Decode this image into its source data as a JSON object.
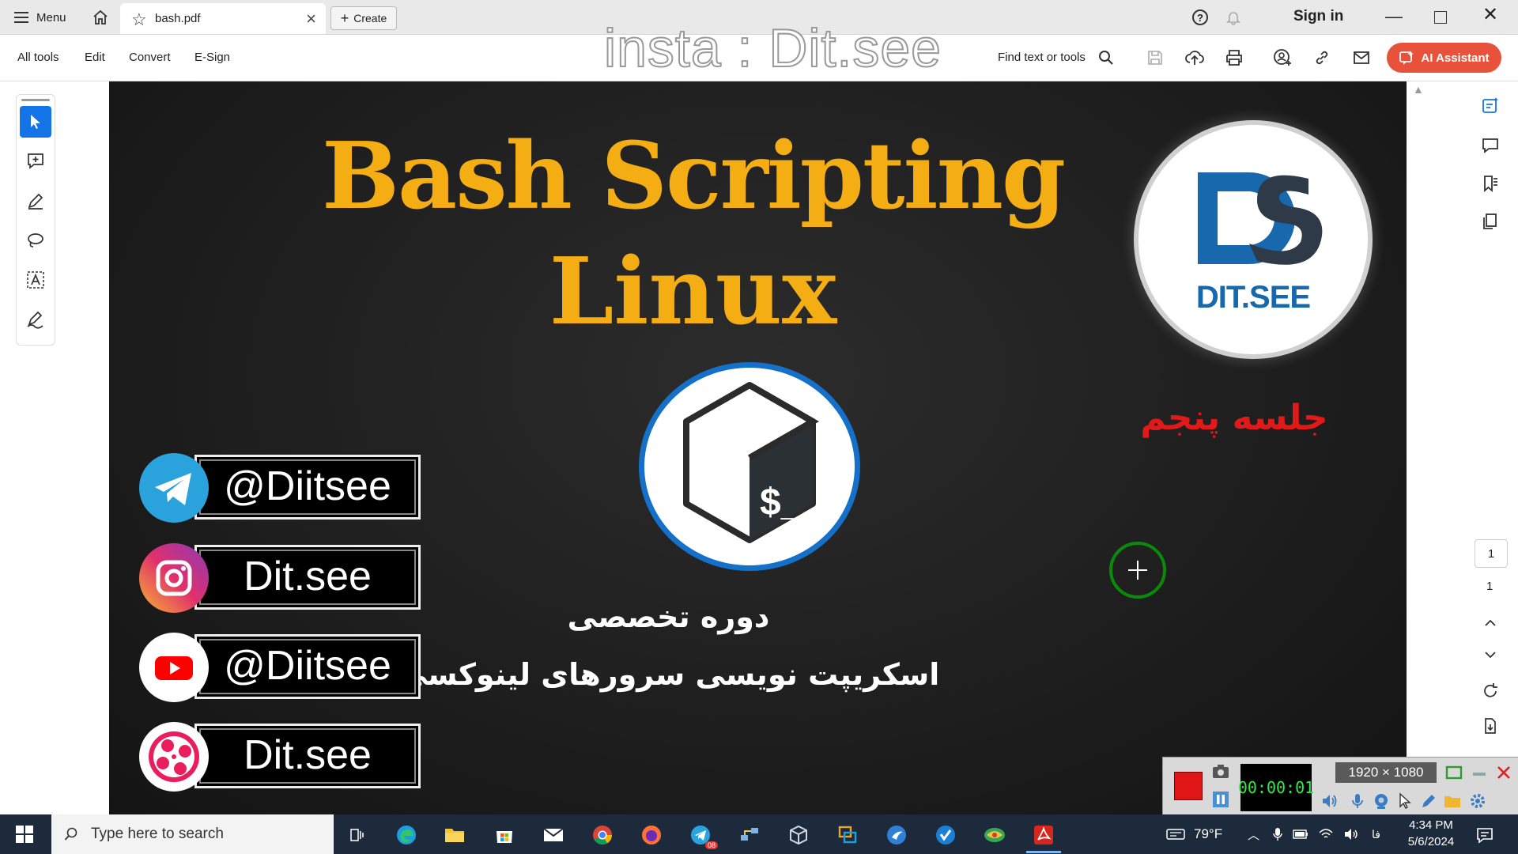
{
  "titlebar": {
    "menu_label": "Menu",
    "tab_title": "bash.pdf",
    "create_label": "Create",
    "sign_in": "Sign in",
    "help_glyph": "?"
  },
  "toolbar": {
    "all_tools": "All tools",
    "edit": "Edit",
    "convert": "Convert",
    "esign": "E-Sign",
    "watermark": "insta : Dit.see",
    "find": "Find text or tools",
    "ai_assistant": "AI Assistant"
  },
  "document": {
    "title_line1": "Bash Scripting",
    "title_line2": "Linux",
    "logo_text": "DIT.SEE",
    "session": "جلسه پنجم",
    "course_line1": "دوره تخصصی",
    "course_line2": "اسکریپت نویسی سرورهای لینوکسی",
    "bash_prompt": "$_",
    "socials": [
      {
        "platform": "telegram",
        "handle": "@Diitsee"
      },
      {
        "platform": "instagram",
        "handle": "Dit.see"
      },
      {
        "platform": "youtube",
        "handle": "@Diitsee"
      },
      {
        "platform": "aparat",
        "handle": "Dit.see"
      }
    ]
  },
  "page_nav": {
    "current": "1",
    "total": "1"
  },
  "recorder": {
    "timer": "00:00:01",
    "resolution": "1920 × 1080"
  },
  "taskbar": {
    "search_placeholder": "Type here to search",
    "weather": "79°F",
    "lang": "فا",
    "time": "4:34 PM",
    "date": "5/6/2024",
    "telegram_badge": "08"
  },
  "colors": {
    "title": "#f5ad14",
    "session": "#e11919",
    "ai_button": "#e8523b",
    "active_tool": "#1473e6",
    "taskbar": "#1c2a3c"
  }
}
